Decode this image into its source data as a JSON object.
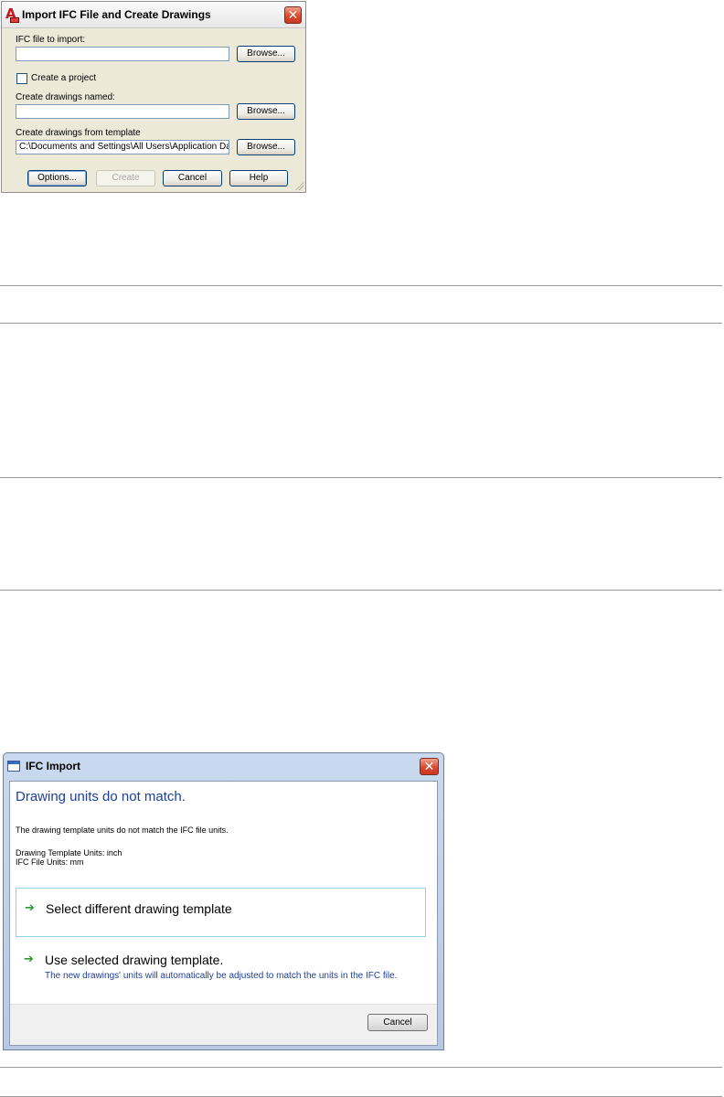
{
  "import_dialog": {
    "title": "Import IFC File and Create Drawings",
    "close_glyph": "✕",
    "ifc_file_label": "IFC file to import:",
    "ifc_file_value": "",
    "create_project_label": "Create a project",
    "create_project_checked": false,
    "drawings_named_label": "Create drawings named:",
    "drawings_named_value": "",
    "template_label": "Create drawings from template",
    "template_value": "C:\\Documents and Settings\\All Users\\Application Data",
    "browse_label": "Browse...",
    "buttons": {
      "options": "Options...",
      "create": "Create",
      "cancel": "Cancel",
      "help": "Help"
    }
  },
  "ifc_import_dialog": {
    "title": "IFC Import",
    "close_glyph": "✕",
    "heading": "Drawing units do not match.",
    "message": "The drawing template units do not match the IFC file units.",
    "template_units": "Drawing Template Units: inch",
    "ifc_units": "IFC File Units: mm",
    "option1": {
      "title": "Select different drawing template"
    },
    "option2": {
      "title": "Use selected drawing template.",
      "description": "The new drawings' units will automatically be adjusted to match the units in the IFC file."
    },
    "arrow_glyph": "➔",
    "cancel_label": "Cancel"
  },
  "colors": {
    "heading_blue": "#1d3f9a",
    "arrow_green": "#2e9a2e",
    "option_border": "#8ed3e6",
    "close_red": "#d8442a"
  },
  "icons": [
    "autocad-app-icon",
    "window-icon",
    "close-icon",
    "green-arrow-icon",
    "resize-grip-icon"
  ]
}
